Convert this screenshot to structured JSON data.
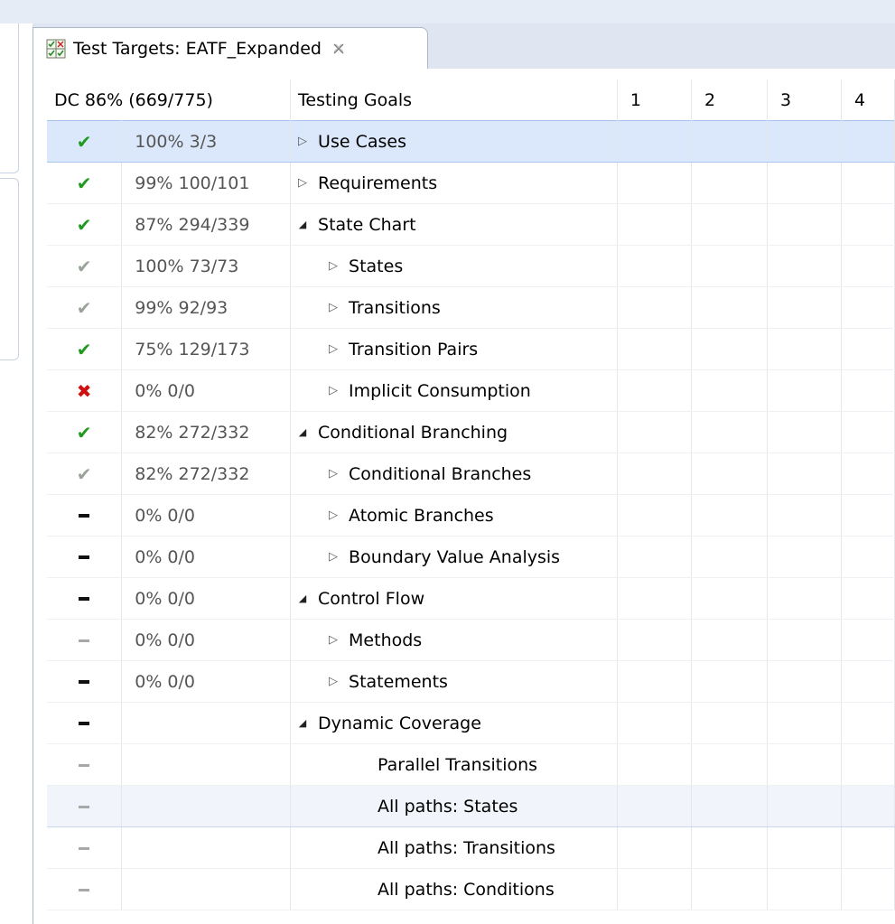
{
  "tab": {
    "title": "Test Targets: EATF_Expanded",
    "icon": "grid-coverage-icon",
    "close_icon": "close-icon"
  },
  "columns": {
    "dc": "DC 86% (669/775)",
    "goals": "Testing Goals",
    "c1": "1",
    "c2": "2",
    "c3": "3",
    "c4": "4"
  },
  "rows": [
    {
      "status": "check-green",
      "pct": "100% 3/3",
      "goal": "Use Cases",
      "level": 0,
      "toggle": "collapsed"
    },
    {
      "status": "check-green",
      "pct": "99% 100/101",
      "goal": "Requirements",
      "level": 0,
      "toggle": "collapsed"
    },
    {
      "status": "check-green",
      "pct": "87% 294/339",
      "goal": "State Chart",
      "level": 0,
      "toggle": "expanded"
    },
    {
      "status": "check-gray",
      "pct": "100% 73/73",
      "goal": "States",
      "level": 1,
      "toggle": "collapsed"
    },
    {
      "status": "check-gray",
      "pct": "99% 92/93",
      "goal": "Transitions",
      "level": 1,
      "toggle": "collapsed"
    },
    {
      "status": "check-green",
      "pct": "75% 129/173",
      "goal": "Transition Pairs",
      "level": 1,
      "toggle": "collapsed"
    },
    {
      "status": "cross-red",
      "pct": "0% 0/0",
      "goal": "Implicit Consumption",
      "level": 1,
      "toggle": "collapsed"
    },
    {
      "status": "check-green",
      "pct": "82% 272/332",
      "goal": "Conditional Branching",
      "level": 0,
      "toggle": "expanded"
    },
    {
      "status": "check-gray",
      "pct": "82% 272/332",
      "goal": "Conditional Branches",
      "level": 1,
      "toggle": "collapsed"
    },
    {
      "status": "dash-black",
      "pct": "0% 0/0",
      "goal": "Atomic Branches",
      "level": 1,
      "toggle": "collapsed"
    },
    {
      "status": "dash-black",
      "pct": "0% 0/0",
      "goal": "Boundary Value Analysis",
      "level": 1,
      "toggle": "collapsed"
    },
    {
      "status": "dash-black",
      "pct": "0% 0/0",
      "goal": "Control Flow",
      "level": 0,
      "toggle": "expanded"
    },
    {
      "status": "dash-gray",
      "pct": "0% 0/0",
      "goal": "Methods",
      "level": 1,
      "toggle": "collapsed"
    },
    {
      "status": "dash-black",
      "pct": "0% 0/0",
      "goal": "Statements",
      "level": 1,
      "toggle": "collapsed"
    },
    {
      "status": "dash-black",
      "pct": "",
      "goal": "Dynamic Coverage",
      "level": 0,
      "toggle": "expanded"
    },
    {
      "status": "dash-gray",
      "pct": "",
      "goal": "Parallel Transitions",
      "level": 2,
      "toggle": "none"
    },
    {
      "status": "dash-gray",
      "pct": "",
      "goal": "All paths: States",
      "level": 2,
      "toggle": "none"
    },
    {
      "status": "dash-gray",
      "pct": "",
      "goal": "All paths: Transitions",
      "level": 2,
      "toggle": "none"
    },
    {
      "status": "dash-gray",
      "pct": "",
      "goal": "All paths: Conditions",
      "level": 2,
      "toggle": "none"
    }
  ],
  "selected_row": 0,
  "hovered_row": 16,
  "colors": {
    "check_green": "#1f9a1f",
    "check_gray": "#9aa39a",
    "cross_red": "#d01010",
    "selection": "#dbe8fb"
  }
}
